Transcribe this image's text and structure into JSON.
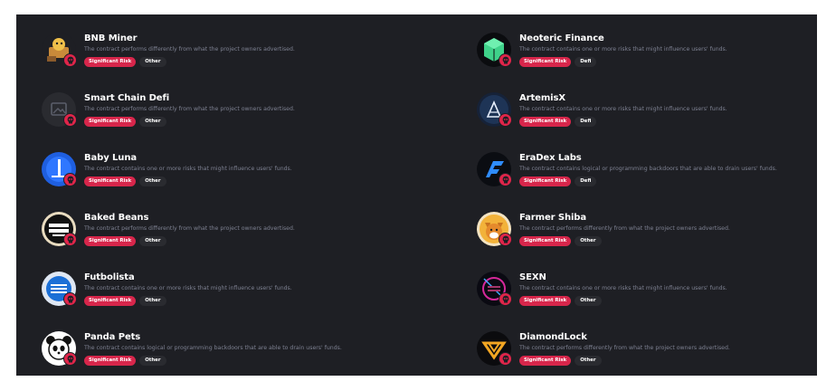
{
  "projects_left": [
    {
      "name": "BNB Miner",
      "description": "The contract performs differently from what the project owners advertised.",
      "risk": "Significant Risk",
      "category": "Other",
      "icon": "bnb-miner-logo-icon"
    },
    {
      "name": "Smart Chain Defi",
      "description": "The contract performs differently from what the project owners advertised.",
      "risk": "Significant Risk",
      "category": "Other",
      "icon": "image-placeholder-icon"
    },
    {
      "name": "Baby Luna",
      "description": "The contract contains one or more risks that might influence users' funds.",
      "risk": "Significant Risk",
      "category": "Other",
      "icon": "baby-luna-logo-icon"
    },
    {
      "name": "Baked Beans",
      "description": "The contract performs differently from what the project owners advertised.",
      "risk": "Significant Risk",
      "category": "Other",
      "icon": "baked-beans-logo-icon"
    },
    {
      "name": "Futbolista",
      "description": "The contract contains one or more risks that might influence users' funds.",
      "risk": "Significant Risk",
      "category": "Other",
      "icon": "futbolista-logo-icon"
    },
    {
      "name": "Panda Pets",
      "description": "The contract contains logical or programming backdoors that are able to drain users' funds.",
      "risk": "Significant Risk",
      "category": "Other",
      "icon": "panda-logo-icon"
    }
  ],
  "projects_right": [
    {
      "name": "Neoteric Finance",
      "description": "The contract contains one or more risks that might influence users' funds.",
      "risk": "Significant Risk",
      "category": "Defi",
      "icon": "neoteric-cube-logo-icon"
    },
    {
      "name": "ArtemisX",
      "description": "The contract contains one or more risks that might influence users' funds.",
      "risk": "Significant Risk",
      "category": "Defi",
      "icon": "artemisx-logo-icon"
    },
    {
      "name": "EraDex Labs",
      "description": "The contract contains logical or programming backdoors that are able to drain users' funds.",
      "risk": "Significant Risk",
      "category": "Defi",
      "icon": "eradex-logo-icon"
    },
    {
      "name": "Farmer Shiba",
      "description": "The contract performs differently from what the project owners advertised.",
      "risk": "Significant Risk",
      "category": "Other",
      "icon": "shiba-dog-logo-icon"
    },
    {
      "name": "SEXN",
      "description": "The contract contains one or more risks that might influence users' funds.",
      "risk": "Significant Risk",
      "category": "Other",
      "icon": "sexn-logo-icon"
    },
    {
      "name": "DiamondLock",
      "description": "The contract performs differently from what the project owners advertised.",
      "risk": "Significant Risk",
      "category": "Other",
      "icon": "diamondlock-logo-icon"
    }
  ],
  "colors": {
    "background": "#1e1f24",
    "risk_badge": "#d7264b",
    "text_muted": "#7d8091"
  }
}
